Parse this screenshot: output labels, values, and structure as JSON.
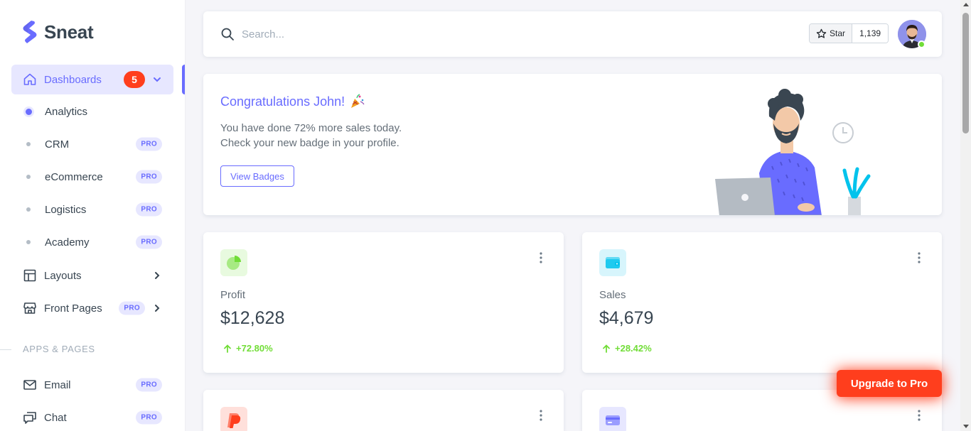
{
  "brand": {
    "name": "Sneat"
  },
  "sidebar": {
    "dashboards": {
      "label": "Dashboards",
      "badge": "5"
    },
    "sub_items": [
      {
        "label": "Analytics",
        "badge": ""
      },
      {
        "label": "CRM",
        "badge": "PRO"
      },
      {
        "label": "eCommerce",
        "badge": "PRO"
      },
      {
        "label": "Logistics",
        "badge": "PRO"
      },
      {
        "label": "Academy",
        "badge": "PRO"
      }
    ],
    "layouts": {
      "label": "Layouts"
    },
    "front_pages": {
      "label": "Front Pages",
      "badge": "PRO"
    },
    "section_header": "APPS & PAGES",
    "email": {
      "label": "Email",
      "badge": "PRO"
    },
    "chat": {
      "label": "Chat",
      "badge": "PRO"
    }
  },
  "navbar": {
    "search_placeholder": "Search...",
    "star_label": "Star",
    "star_count": "1,139"
  },
  "welcome": {
    "title": "Congratulations John!",
    "line1": "You have done 72% more sales today.",
    "line2": "Check your new badge in your profile.",
    "button": "View Badges"
  },
  "stats": [
    {
      "label": "Profit",
      "value": "$12,628",
      "change": "+72.80%"
    },
    {
      "label": "Sales",
      "value": "$4,679",
      "change": "+28.42%"
    }
  ],
  "upgrade_label": "Upgrade to Pro",
  "colors": {
    "primary": "#696cff",
    "danger": "#ff3e1d",
    "success": "#71dd37",
    "info": "#03c3ec"
  }
}
